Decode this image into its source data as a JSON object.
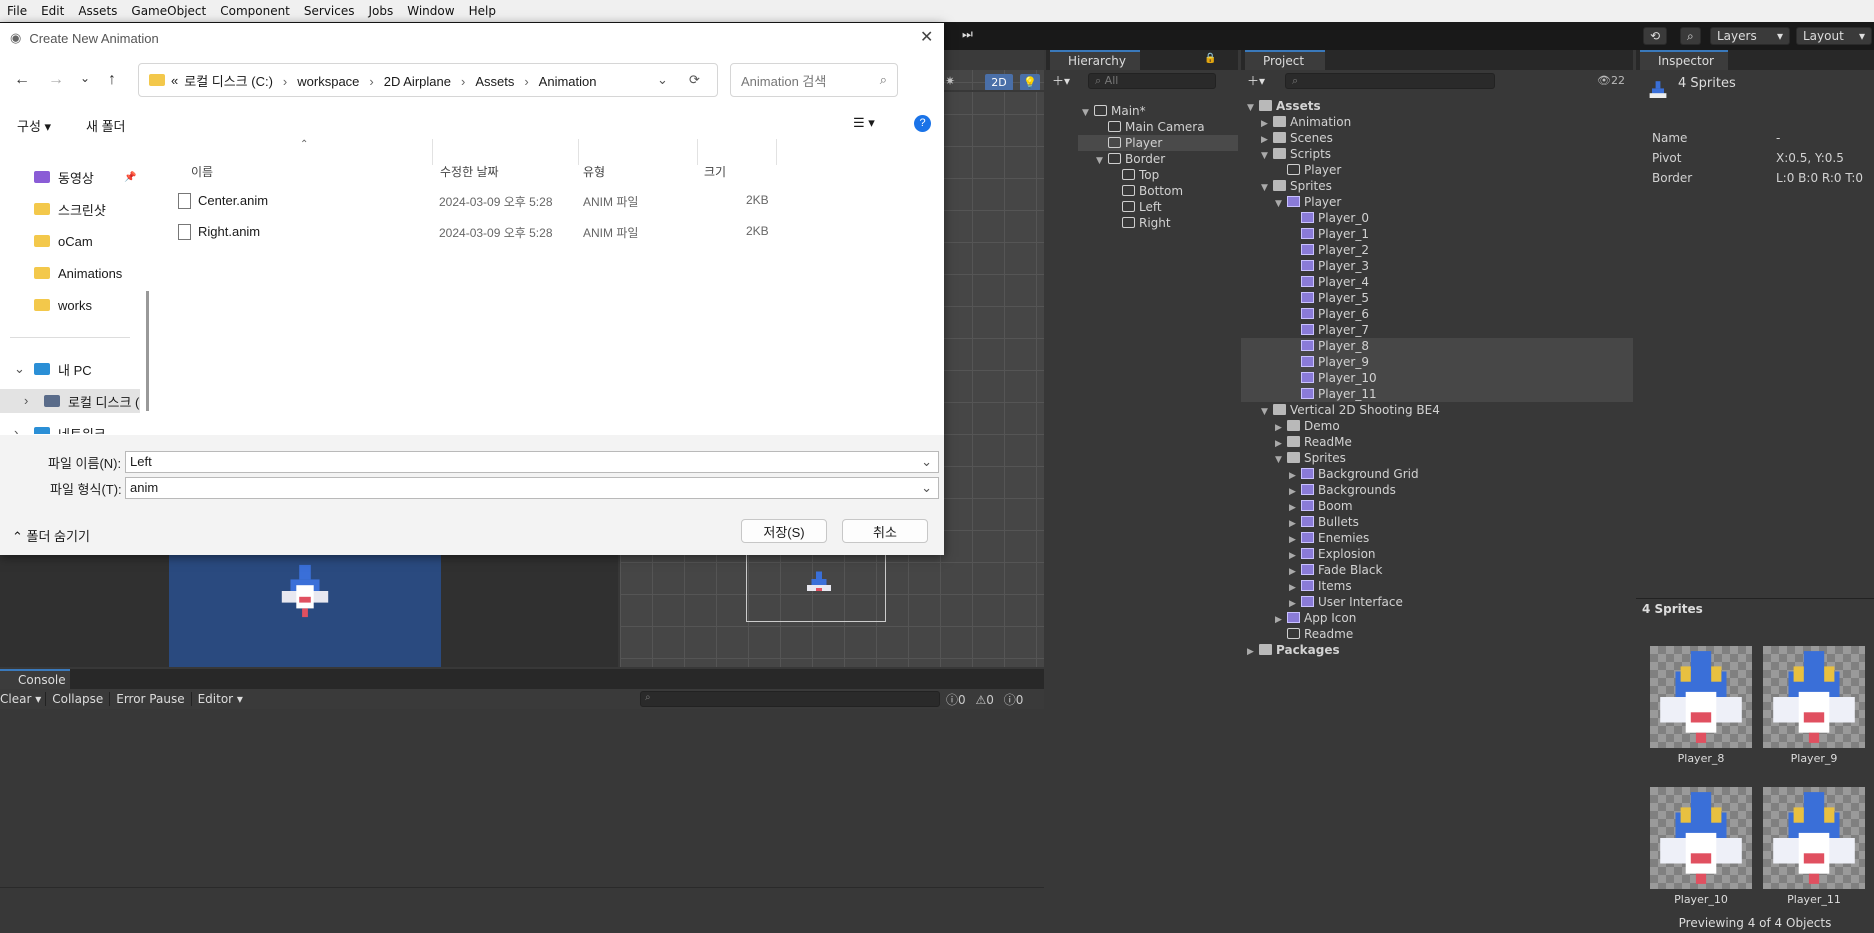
{
  "menu": [
    "File",
    "Edit",
    "Assets",
    "GameObject",
    "Component",
    "Services",
    "Jobs",
    "Window",
    "Help"
  ],
  "toolbar": {
    "layers": "Layers",
    "layout": "Layout"
  },
  "hierarchy": {
    "tab": "Hierarchy",
    "search_placeholder": "All",
    "items": [
      {
        "label": "Main*",
        "depth": 0,
        "arrow": "▼"
      },
      {
        "label": "Main Camera",
        "depth": 1,
        "arrow": ""
      },
      {
        "label": "Player",
        "depth": 1,
        "arrow": "",
        "selected": true
      },
      {
        "label": "Border",
        "depth": 1,
        "arrow": "▼"
      },
      {
        "label": "Top",
        "depth": 2,
        "arrow": ""
      },
      {
        "label": "Bottom",
        "depth": 2,
        "arrow": ""
      },
      {
        "label": "Left",
        "depth": 2,
        "arrow": ""
      },
      {
        "label": "Right",
        "depth": 2,
        "arrow": ""
      }
    ]
  },
  "project": {
    "tab": "Project",
    "count": "22",
    "items": [
      {
        "label": "Assets",
        "depth": 0,
        "arrow": "▼",
        "icon": "folder",
        "bold": true
      },
      {
        "label": "Animation",
        "depth": 1,
        "arrow": "▶",
        "icon": "folder"
      },
      {
        "label": "Scenes",
        "depth": 1,
        "arrow": "▶",
        "icon": "folder"
      },
      {
        "label": "Scripts",
        "depth": 1,
        "arrow": "▼",
        "icon": "folder"
      },
      {
        "label": "Player",
        "depth": 2,
        "arrow": "",
        "icon": "script"
      },
      {
        "label": "Sprites",
        "depth": 1,
        "arrow": "▼",
        "icon": "folder"
      },
      {
        "label": "Player",
        "depth": 2,
        "arrow": "▼",
        "icon": "sheet"
      },
      {
        "label": "Player_0",
        "depth": 3,
        "arrow": "",
        "icon": "sprite"
      },
      {
        "label": "Player_1",
        "depth": 3,
        "arrow": "",
        "icon": "sprite"
      },
      {
        "label": "Player_2",
        "depth": 3,
        "arrow": "",
        "icon": "sprite"
      },
      {
        "label": "Player_3",
        "depth": 3,
        "arrow": "",
        "icon": "sprite"
      },
      {
        "label": "Player_4",
        "depth": 3,
        "arrow": "",
        "icon": "sprite"
      },
      {
        "label": "Player_5",
        "depth": 3,
        "arrow": "",
        "icon": "sprite"
      },
      {
        "label": "Player_6",
        "depth": 3,
        "arrow": "",
        "icon": "sprite"
      },
      {
        "label": "Player_7",
        "depth": 3,
        "arrow": "",
        "icon": "sprite"
      },
      {
        "label": "Player_8",
        "depth": 3,
        "arrow": "",
        "icon": "sprite",
        "selected": true
      },
      {
        "label": "Player_9",
        "depth": 3,
        "arrow": "",
        "icon": "sprite",
        "selected": true
      },
      {
        "label": "Player_10",
        "depth": 3,
        "arrow": "",
        "icon": "sprite",
        "selected": true
      },
      {
        "label": "Player_11",
        "depth": 3,
        "arrow": "",
        "icon": "sprite",
        "selected": true
      },
      {
        "label": "Vertical 2D Shooting BE4",
        "depth": 1,
        "arrow": "▼",
        "icon": "folder"
      },
      {
        "label": "Demo",
        "depth": 2,
        "arrow": "▶",
        "icon": "folder"
      },
      {
        "label": "ReadMe",
        "depth": 2,
        "arrow": "▶",
        "icon": "folder"
      },
      {
        "label": "Sprites",
        "depth": 2,
        "arrow": "▼",
        "icon": "folder"
      },
      {
        "label": "Background Grid",
        "depth": 3,
        "arrow": "▶",
        "icon": "sheet"
      },
      {
        "label": "Backgrounds",
        "depth": 3,
        "arrow": "▶",
        "icon": "sheet"
      },
      {
        "label": "Boom",
        "depth": 3,
        "arrow": "▶",
        "icon": "sheet"
      },
      {
        "label": "Bullets",
        "depth": 3,
        "arrow": "▶",
        "icon": "sheet"
      },
      {
        "label": "Enemies",
        "depth": 3,
        "arrow": "▶",
        "icon": "sheet"
      },
      {
        "label": "Explosion",
        "depth": 3,
        "arrow": "▶",
        "icon": "sheet"
      },
      {
        "label": "Fade Black",
        "depth": 3,
        "arrow": "▶",
        "icon": "sheet"
      },
      {
        "label": "Items",
        "depth": 3,
        "arrow": "▶",
        "icon": "sheet"
      },
      {
        "label": "User Interface",
        "depth": 3,
        "arrow": "▶",
        "icon": "sheet"
      },
      {
        "label": "App Icon",
        "depth": 2,
        "arrow": "▶",
        "icon": "sheet"
      },
      {
        "label": "Readme",
        "depth": 2,
        "arrow": "",
        "icon": "cube"
      },
      {
        "label": "Packages",
        "depth": 0,
        "arrow": "▶",
        "icon": "folder",
        "bold": true
      }
    ]
  },
  "inspector": {
    "tab": "Inspector",
    "title": "4 Sprites",
    "props": [
      {
        "name": "Name",
        "value": "-"
      },
      {
        "name": "Pivot",
        "value": "X:0.5, Y:0.5"
      },
      {
        "name": "Border",
        "value": "L:0 B:0 R:0 T:0"
      }
    ],
    "preview_header": "4 Sprites",
    "previews": [
      "Player_8",
      "Player_9",
      "Player_10",
      "Player_11"
    ],
    "footer": "Previewing 4 of 4 Objects"
  },
  "console": {
    "tab": "Console",
    "clear": "Clear",
    "collapse": "Collapse",
    "error_pause": "Error Pause",
    "editor": "Editor",
    "log_count": "0",
    "warn_count": "0",
    "error_count": "0"
  },
  "scene": {
    "mode_2d": "2D"
  },
  "dialog": {
    "title": "Create New Animation",
    "breadcrumb": [
      "로컬 디스크 (C:)",
      "workspace",
      "2D Airplane",
      "Assets",
      "Animation"
    ],
    "search_placeholder": "Animation 검색",
    "organize": "구성",
    "new_folder": "새 폴더",
    "nav_items": [
      {
        "label": "동영상",
        "icon": "video"
      },
      {
        "label": "스크린샷",
        "icon": "folder"
      },
      {
        "label": "oCam",
        "icon": "folder"
      },
      {
        "label": "Animations",
        "icon": "folder"
      },
      {
        "label": "works",
        "icon": "folder"
      }
    ],
    "this_pc": "내 PC",
    "local_disk": "로컬 디스크 (C:)",
    "network": "네트워크",
    "columns": {
      "name": "이름",
      "date": "수정한 날짜",
      "type": "유형",
      "size": "크기"
    },
    "files": [
      {
        "name": "Center.anim",
        "date": "2024-03-09 오후 5:28",
        "type": "ANIM 파일",
        "size": "2KB"
      },
      {
        "name": "Right.anim",
        "date": "2024-03-09 오후 5:28",
        "type": "ANIM 파일",
        "size": "2KB"
      }
    ],
    "filename_label": "파일 이름(N):",
    "filename_value": "Left",
    "filetype_label": "파일 형식(T):",
    "filetype_value": "anim",
    "hide_folders": "폴더 숨기기",
    "save": "저장(S)",
    "cancel": "취소"
  }
}
